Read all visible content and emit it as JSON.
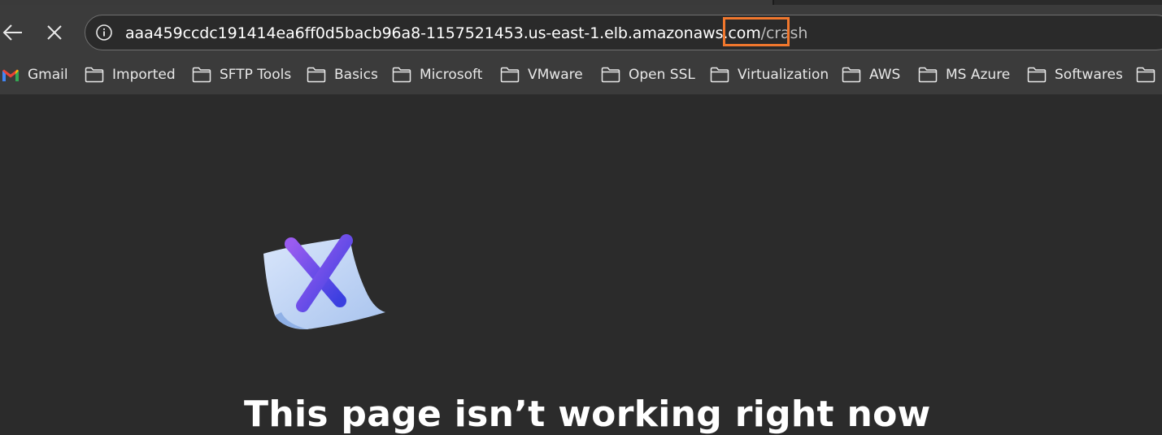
{
  "address_bar": {
    "url_host": "aaa459ccdc191414ea6ff0d5bacb96a8-1157521453.us-east-1.elb.amazonaws.co",
    "url_host_tail": "m",
    "url_path": "/crash"
  },
  "bookmarks": [
    {
      "label": "Gmail",
      "icon": "gmail-icon"
    },
    {
      "label": "Imported",
      "icon": "folder-icon"
    },
    {
      "label": "SFTP Tools",
      "icon": "folder-icon"
    },
    {
      "label": "Basics",
      "icon": "folder-icon"
    },
    {
      "label": "Microsoft",
      "icon": "folder-icon"
    },
    {
      "label": "VMware",
      "icon": "folder-icon"
    },
    {
      "label": "Open SSL",
      "icon": "folder-icon"
    },
    {
      "label": "Virtualization",
      "icon": "folder-icon"
    },
    {
      "label": "AWS",
      "icon": "folder-icon"
    },
    {
      "label": "MS Azure",
      "icon": "folder-icon"
    },
    {
      "label": "Softwares",
      "icon": "folder-icon"
    }
  ],
  "error_page": {
    "title": "This page isn’t working right now",
    "icon": "error-page-icon"
  },
  "colors": {
    "highlight": "#f0772d",
    "background": "#2b2b2b",
    "toolbar": "#3b3b3b"
  }
}
